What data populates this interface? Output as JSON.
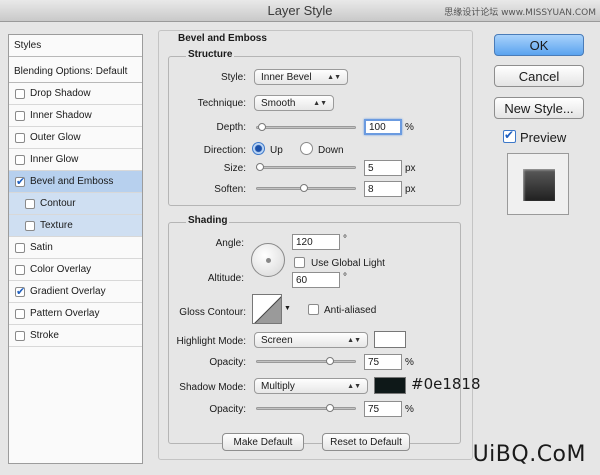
{
  "window": {
    "title": "Layer Style",
    "watermark": "思缘设计论坛 www.MISSYUAN.COM",
    "logo": "UiBQ.CoM"
  },
  "sidebar": {
    "header": "Styles",
    "blending": "Blending Options: Default",
    "items": [
      {
        "label": "Drop Shadow",
        "checked": false,
        "selected": false,
        "sub": false
      },
      {
        "label": "Inner Shadow",
        "checked": false,
        "selected": false,
        "sub": false
      },
      {
        "label": "Outer Glow",
        "checked": false,
        "selected": false,
        "sub": false
      },
      {
        "label": "Inner Glow",
        "checked": false,
        "selected": false,
        "sub": false
      },
      {
        "label": "Bevel and Emboss",
        "checked": true,
        "selected": true,
        "sub": false
      },
      {
        "label": "Contour",
        "checked": false,
        "selected": false,
        "sub": true
      },
      {
        "label": "Texture",
        "checked": false,
        "selected": false,
        "sub": true
      },
      {
        "label": "Satin",
        "checked": false,
        "selected": false,
        "sub": false
      },
      {
        "label": "Color Overlay",
        "checked": false,
        "selected": false,
        "sub": false
      },
      {
        "label": "Gradient Overlay",
        "checked": true,
        "selected": false,
        "sub": false
      },
      {
        "label": "Pattern Overlay",
        "checked": false,
        "selected": false,
        "sub": false
      },
      {
        "label": "Stroke",
        "checked": false,
        "selected": false,
        "sub": false
      }
    ]
  },
  "bevel": {
    "section_title": "Bevel and Emboss",
    "structure": {
      "title": "Structure",
      "style_label": "Style:",
      "style_value": "Inner Bevel",
      "technique_label": "Technique:",
      "technique_value": "Smooth",
      "depth_label": "Depth:",
      "depth_value": "100",
      "depth_unit": "%",
      "direction_label": "Direction:",
      "direction_up": "Up",
      "direction_down": "Down",
      "size_label": "Size:",
      "size_value": "5",
      "size_unit": "px",
      "soften_label": "Soften:",
      "soften_value": "8",
      "soften_unit": "px"
    },
    "shading": {
      "title": "Shading",
      "angle_label": "Angle:",
      "angle_value": "120",
      "angle_unit": "°",
      "global_light_label": "Use Global Light",
      "altitude_label": "Altitude:",
      "altitude_value": "60",
      "altitude_unit": "°",
      "gloss_label": "Gloss Contour:",
      "anti_aliased_label": "Anti-aliased",
      "highlight_mode_label": "Highlight Mode:",
      "highlight_mode_value": "Screen",
      "highlight_color": "#ffffff",
      "highlight_opacity_label": "Opacity:",
      "highlight_opacity_value": "75",
      "highlight_opacity_unit": "%",
      "shadow_mode_label": "Shadow Mode:",
      "shadow_mode_value": "Multiply",
      "shadow_color": "#0e1818",
      "shadow_color_annotation": "#0e1818",
      "shadow_opacity_label": "Opacity:",
      "shadow_opacity_value": "75",
      "shadow_opacity_unit": "%"
    },
    "make_default": "Make Default",
    "reset_default": "Reset to Default"
  },
  "actions": {
    "ok": "OK",
    "cancel": "Cancel",
    "new_style": "New Style...",
    "preview_label": "Preview"
  }
}
